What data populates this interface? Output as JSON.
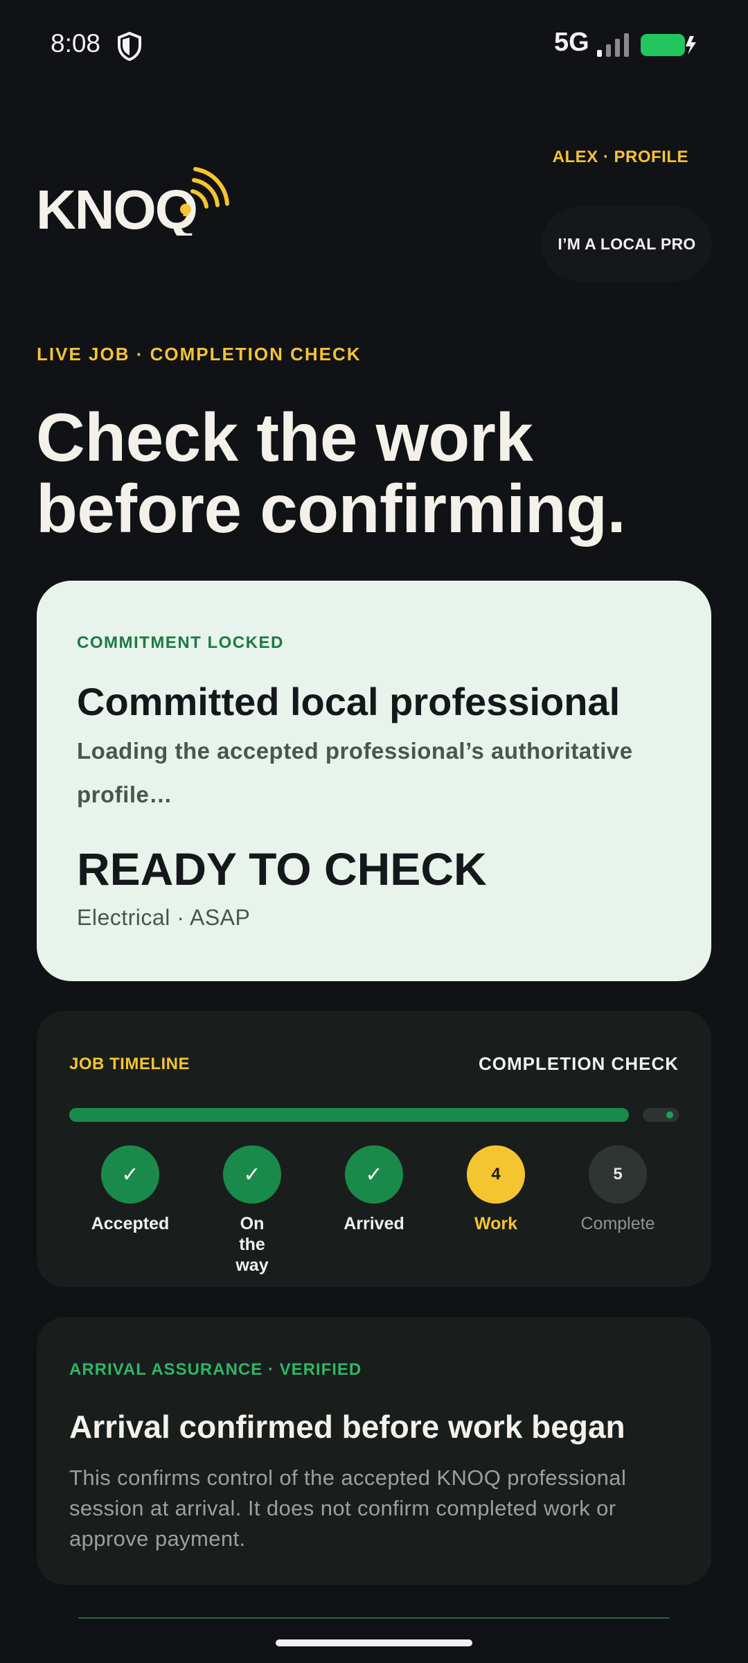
{
  "status_bar": {
    "time": "8:08",
    "network": "5G",
    "icons": [
      "shield-icon",
      "signal-icon",
      "battery-charging-icon"
    ],
    "battery_color": "#22c55e"
  },
  "header": {
    "logo_text": "KNOQ",
    "profile_link": "ALEX · PROFILE",
    "pro_button": "I’M A LOCAL PRO"
  },
  "hero": {
    "eyebrow": "LIVE JOB · COMPLETION CHECK",
    "headline_line1": "Check the work",
    "headline_line2": "before confirming."
  },
  "commitment_card": {
    "eyebrow": "COMMITMENT LOCKED",
    "title": "Committed local professional",
    "subtitle": "Loading the accepted professional’s authoritative profile…",
    "status": "READY TO CHECK",
    "meta": "Electrical · ASAP"
  },
  "timeline": {
    "label": "JOB TIMELINE",
    "current_stage": "COMPLETION CHECK",
    "progress": 0.93,
    "steps": [
      {
        "marker": "✓",
        "label": "Accepted",
        "state": "done"
      },
      {
        "marker": "✓",
        "label": "On the way",
        "state": "done"
      },
      {
        "marker": "✓",
        "label": "Arrived",
        "state": "done"
      },
      {
        "marker": "4",
        "label": "Work",
        "state": "current"
      },
      {
        "marker": "5",
        "label": "Complete",
        "state": "upcoming"
      }
    ]
  },
  "arrival_card": {
    "eyebrow": "ARRIVAL ASSURANCE · VERIFIED",
    "title": "Arrival confirmed before work began",
    "body": "This confirms control of the accepted KNOQ professional session at arrival. It does not confirm completed work or approve payment."
  },
  "colors": {
    "accent": "#f5c431",
    "success": "#1a8a4a",
    "background": "#111215",
    "card_light": "#e8f3ec"
  }
}
